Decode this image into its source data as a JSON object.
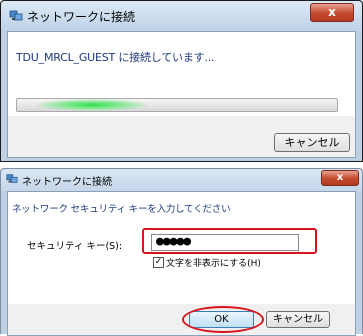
{
  "dialog1": {
    "title": "ネットワークに接続",
    "close_label": "x",
    "message": "TDU_MRCL_GUEST に接続しています...",
    "progress_state": "indeterminate",
    "cancel_label": "キャンセル"
  },
  "dialog2": {
    "title": "ネットワークに接続",
    "close_label": "x",
    "instruction": "ネットワーク セキュリティ キーを入力してください",
    "key_label": "セキュリティ キー(S):",
    "key_value": "●●●●●",
    "hide_chars_checked": true,
    "hide_chars_check_mark": "✓",
    "hide_chars_label": "文字を非表示にする(H)",
    "ok_label": "OK",
    "cancel_label": "キャンセル"
  },
  "colors": {
    "highlight": "#d8141c",
    "text_blue": "#1e3a7b",
    "progress_glow": "#2ee04a"
  },
  "icons": [
    "network-icon",
    "close-icon",
    "check-icon"
  ]
}
